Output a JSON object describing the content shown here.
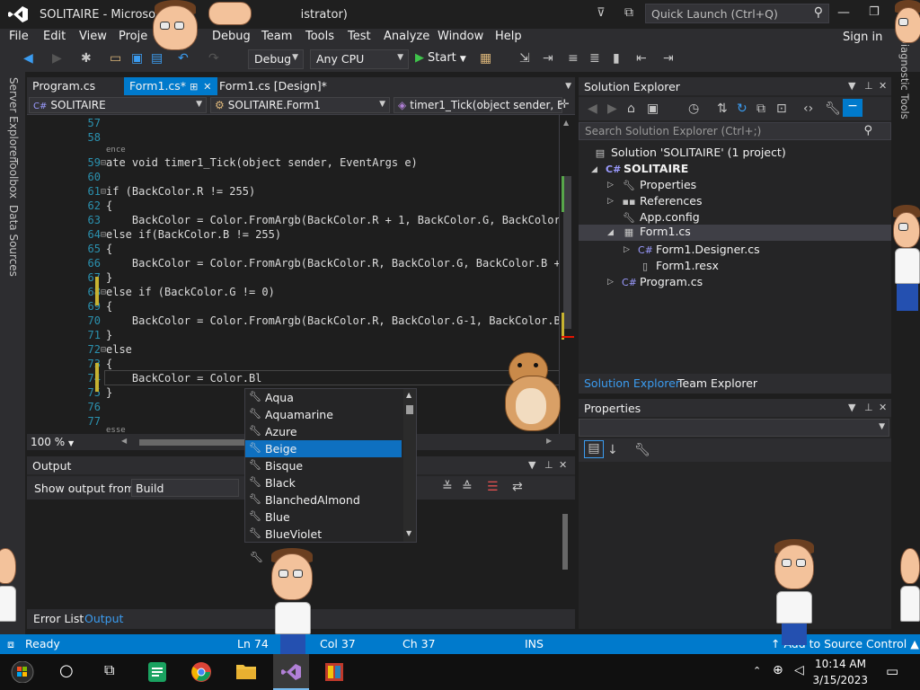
{
  "window": {
    "title_start": "SOLITAIRE - Microsoft",
    "title_end": "istrator)",
    "quick_launch_placeholder": "Quick Launch (Ctrl+Q)",
    "sign_in": "Sign in"
  },
  "menu": [
    "File",
    "Edit",
    "View",
    "Proje",
    "Debug",
    "Team",
    "Tools",
    "Test",
    "Analyze",
    "Window",
    "Help"
  ],
  "toolbar": {
    "config": "Debug",
    "platform": "Any CPU",
    "start": "Start"
  },
  "left_tabs": [
    "Server Explorer",
    "Toolbox",
    "Data Sources"
  ],
  "right_tab": "Diagnostic Tools",
  "doc_tabs": {
    "program": "Program.cs",
    "form1_cs": "Form1.cs*",
    "form1_design": "Form1.cs [Design]*"
  },
  "nav": {
    "project": "SOLITAIRE",
    "class": "SOLITAIRE.Form1",
    "member": "timer1_Tick(object sender, Ever"
  },
  "editor": {
    "line_numbers": [
      "57",
      "58",
      "59",
      "60",
      "61",
      "62",
      "63",
      "64",
      "65",
      "66",
      "67",
      "68",
      "69",
      "70",
      "71",
      "72",
      "73",
      "74",
      "75",
      "76",
      "77"
    ],
    "codelens": "ence",
    "zoom": "100 %",
    "lines": {
      "l59": "ate void timer1_Tick(object sender, EventArgs e)",
      "l61": "if (BackColor.R != 255)",
      "l62": "{",
      "l63": "    BackColor = Color.FromArgb(BackColor.R + 1, BackColor.G, BackColor.E",
      "l64": "else if(BackColor.B != 255)",
      "l65": "{",
      "l66": "    BackColor = Color.FromArgb(BackColor.R, BackColor.G, BackColor.B + 1",
      "l67": "}",
      "l68": "else if (BackColor.G != 0)",
      "l69": "{",
      "l70": "    BackColor = Color.FromArgb(BackColor.R, BackColor.G-1, BackColor.B);",
      "l71": "}",
      "l72": "else",
      "l73": "{",
      "l74": "    BackColor = Color.Bl",
      "l75": "}",
      "l77": "esse"
    }
  },
  "intellisense": {
    "items": [
      "Aqua",
      "Aquamarine",
      "Azure",
      "Beige",
      "Bisque",
      "Black",
      "BlanchedAlmond",
      "Blue",
      "BlueViolet"
    ],
    "selected": "Beige"
  },
  "output": {
    "title": "Output",
    "show_from_label": "Show output from:",
    "source": "Build"
  },
  "bottom_tabs": [
    "Error List",
    "Output"
  ],
  "solution_explorer": {
    "title": "Solution Explorer",
    "search_placeholder": "Search Solution Explorer (Ctrl+;)",
    "nodes": [
      "Solution 'SOLITAIRE' (1 project)",
      "SOLITAIRE",
      "Properties",
      "References",
      "App.config",
      "Form1.cs",
      "Form1.Designer.cs",
      "Form1.resx",
      "Program.cs"
    ],
    "tabs": [
      "Solution Explorer",
      "Team Explorer"
    ]
  },
  "properties": {
    "title": "Properties"
  },
  "status": {
    "ready": "Ready",
    "ln": "Ln 74",
    "col": "Col 37",
    "ch": "Ch 37",
    "ins": "INS",
    "source_control": "Add to Source Control"
  },
  "taskbar": {
    "time": "10:14 AM",
    "date": "3/15/2023"
  },
  "colors": {
    "accent": "#007acc",
    "selection": "#0e70c0"
  }
}
